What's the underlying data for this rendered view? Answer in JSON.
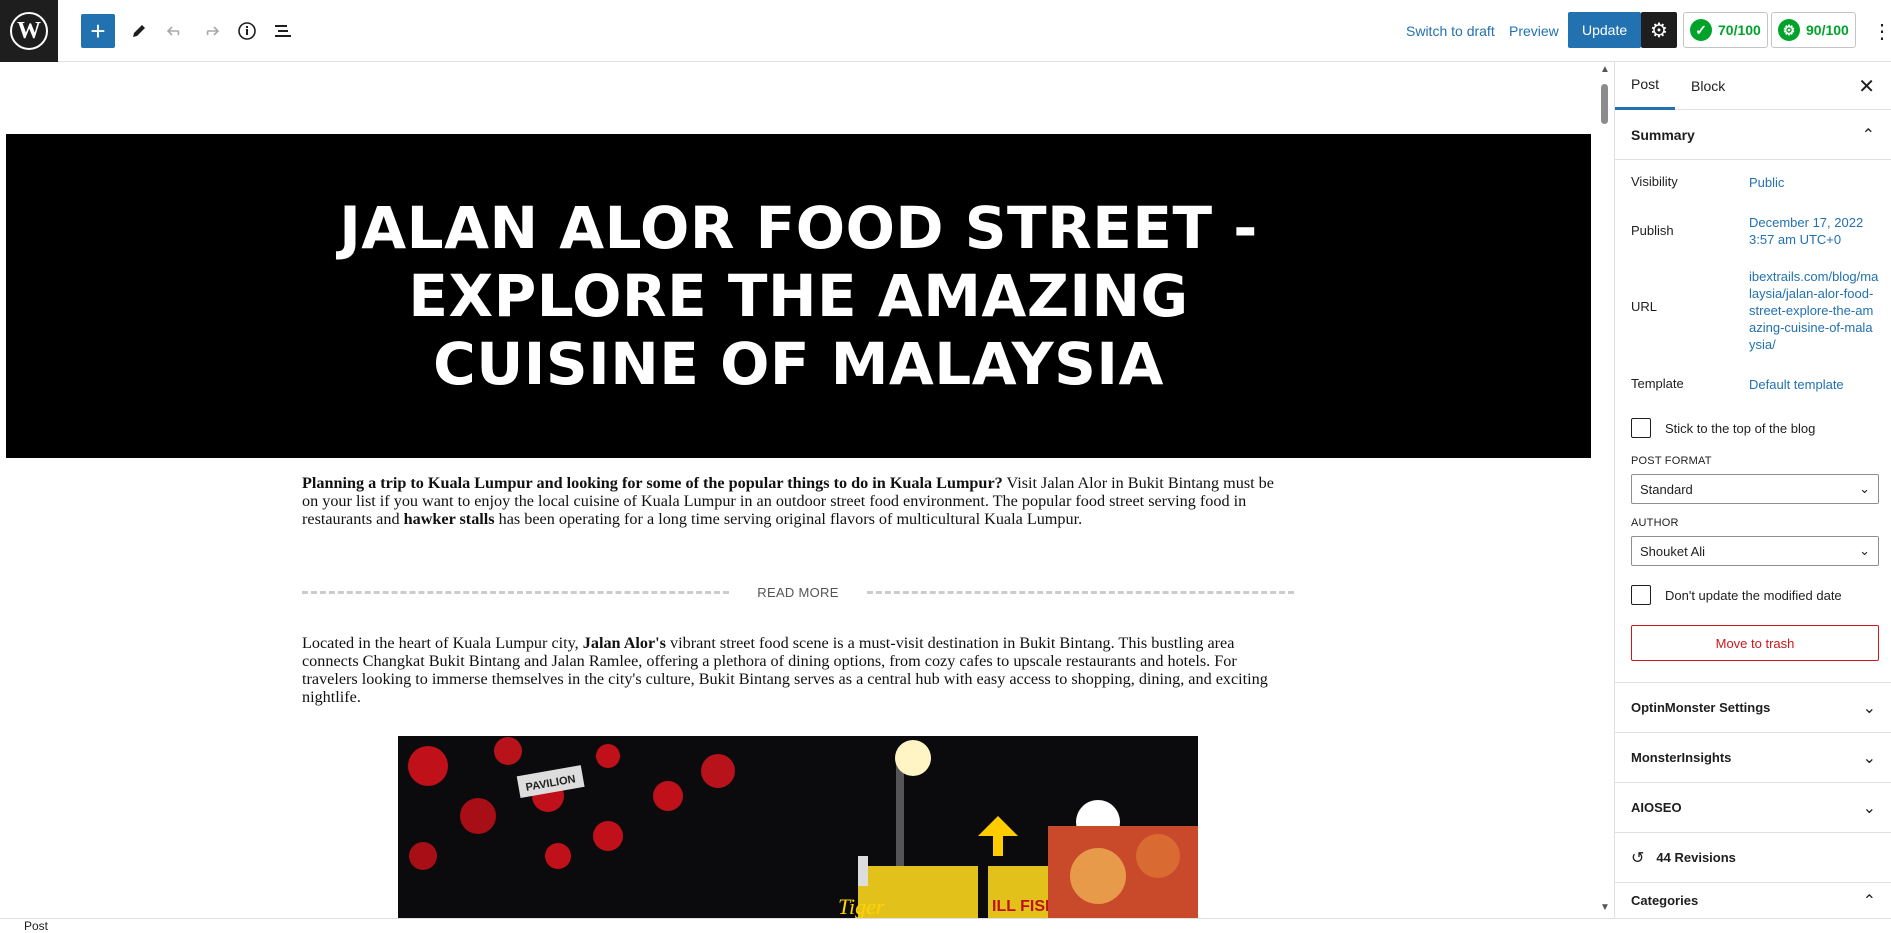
{
  "toolbar": {
    "add_label": "+",
    "switch_draft": "Switch to draft",
    "preview": "Preview",
    "update": "Update",
    "score1": "70/100",
    "score2": "90/100"
  },
  "post": {
    "title": "JALAN ALOR FOOD STREET - EXPLORE THE AMAZING CUISINE OF MALAYSIA",
    "p1_bold": "Planning a trip to Kuala Lumpur and looking for some of the popular things to do in Kuala Lumpur?",
    "p1_text_a": " Visit Jalan Alor in Bukit Bintang must be on your list if you want to enjoy the local cuisine of Kuala Lumpur in an outdoor street food environment. The popular food street serving food in restaurants and ",
    "p1_bold2": "hawker stalls",
    "p1_text_b": " has been operating for a long time serving original flavors of multicultural Kuala Lumpur.",
    "read_more": "READ MORE",
    "p2_text_a": "Located in the heart of Kuala Lumpur city, ",
    "p2_bold": "Jalan Alor's",
    "p2_text_b": " vibrant street food scene is a must-visit destination in Bukit Bintang. This bustling area connects Changkat Bukit Bintang and Jalan Ramlee, offering a plethora of dining options, from cozy cafes to upscale restaurants and hotels. For travelers looking to immerse themselves in the city's culture, Bukit Bintang serves as a central hub with easy access to shopping, dining, and exciting nightlife.",
    "image_signs": [
      "PAVILION",
      "Tiger",
      "ILL FISH"
    ]
  },
  "sidebar": {
    "tab_post": "Post",
    "tab_block": "Block",
    "summary": "Summary",
    "visibility_label": "Visibility",
    "visibility_value": "Public",
    "publish_label": "Publish",
    "publish_value": "December 17, 2022 3:57 am UTC+0",
    "url_label": "URL",
    "url_value": "ibextrails.com/blog/malaysia/jalan-alor-food-street-explore-the-amazing-cuisine-of-malaysia/",
    "template_label": "Template",
    "template_value": "Default template",
    "stick_label": "Stick to the top of the blog",
    "post_format_label": "POST FORMAT",
    "post_format_value": "Standard",
    "author_label": "AUTHOR",
    "author_value": "Shouket Ali",
    "dont_update_label": "Don't update the modified date",
    "trash": "Move to trash",
    "optin": "OptinMonster Settings",
    "monster": "MonsterInsights",
    "aioseo": "AIOSEO",
    "revisions": "44 Revisions",
    "categories": "Categories"
  },
  "status": {
    "breadcrumb": "Post"
  }
}
